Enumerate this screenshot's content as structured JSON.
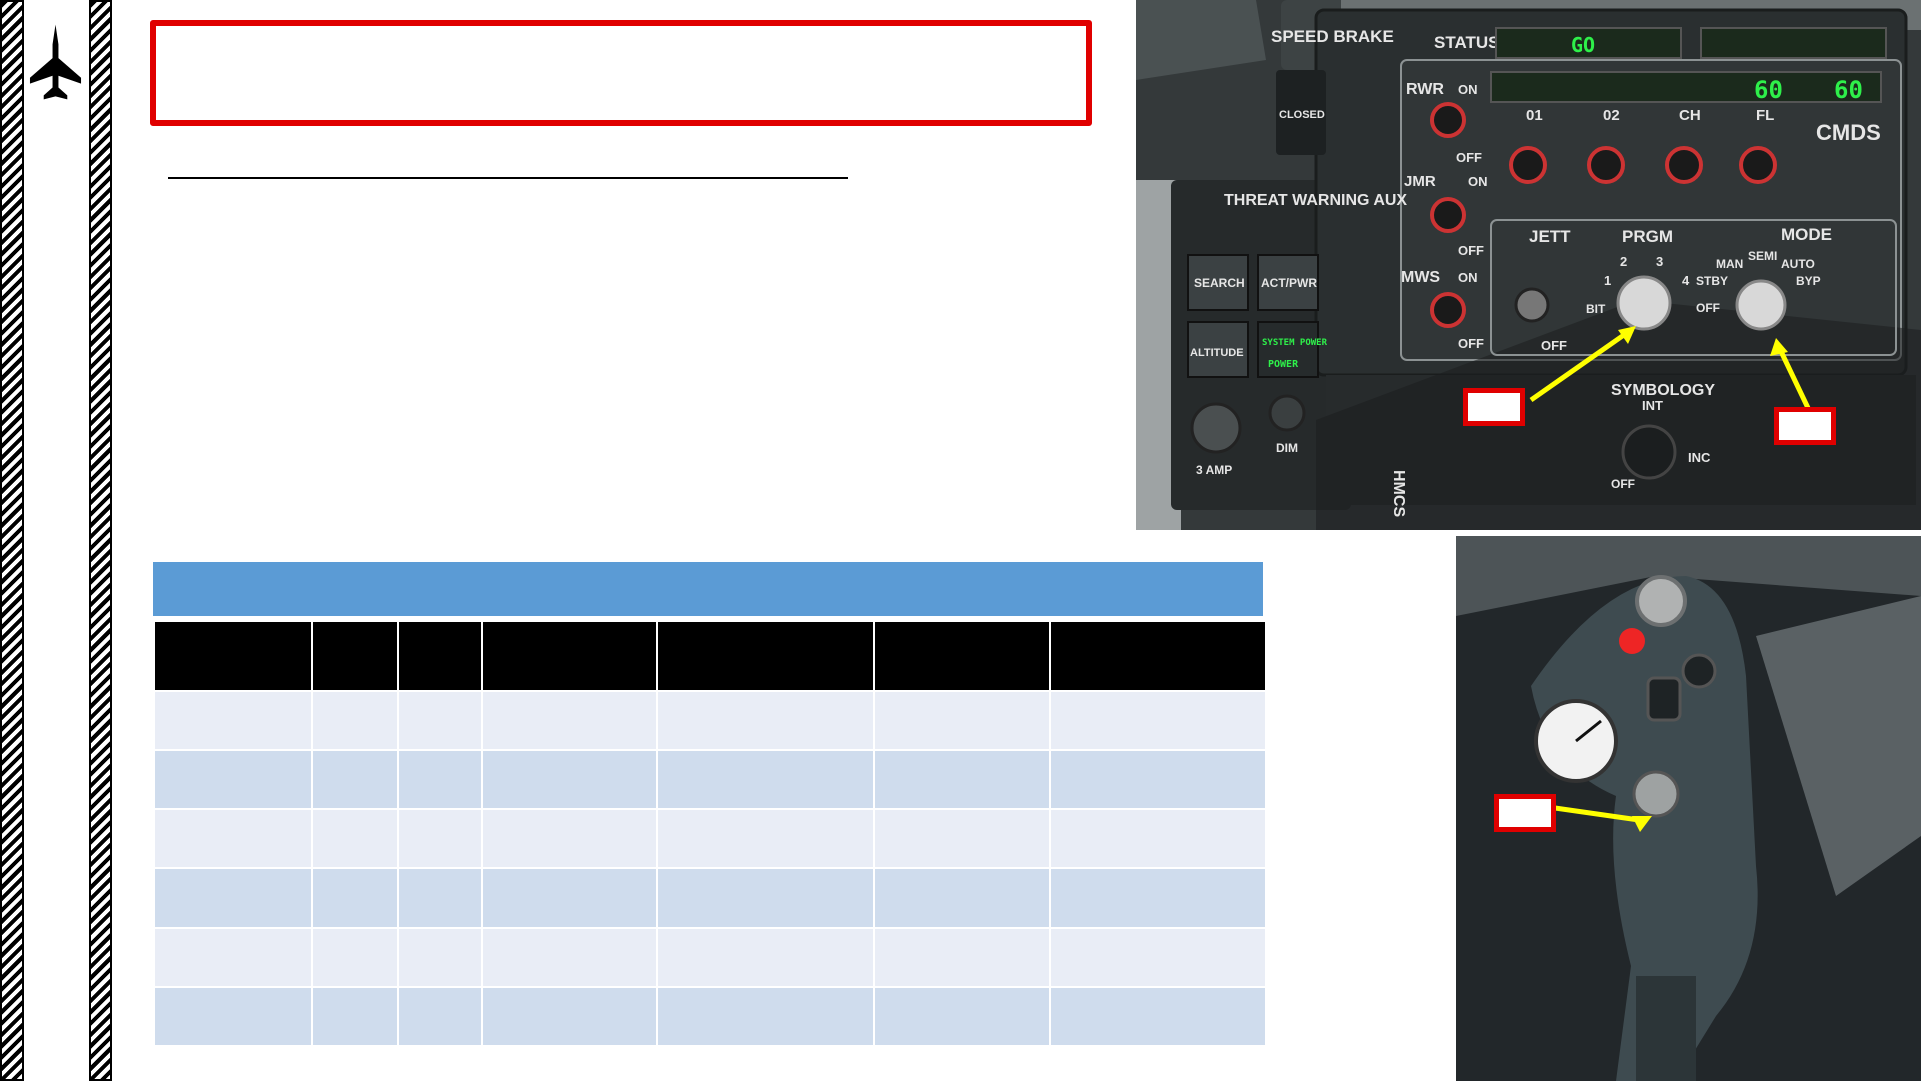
{
  "page": {
    "title": "",
    "subtitle": "",
    "footnote": ""
  },
  "table": {
    "header_title": "",
    "columns": [
      "",
      "",
      "",
      "",
      "",
      "",
      ""
    ],
    "rows": [
      [
        "",
        "",
        "",
        "",
        "",
        "",
        ""
      ],
      [
        "",
        "",
        "",
        "",
        "",
        "",
        ""
      ],
      [
        "",
        "",
        "",
        "",
        "",
        "",
        ""
      ],
      [
        "",
        "",
        "",
        "",
        "",
        "",
        ""
      ],
      [
        "",
        "",
        "",
        "",
        "",
        "",
        ""
      ],
      [
        "",
        "",
        "",
        "",
        "",
        "",
        ""
      ]
    ]
  },
  "cmds_panel": {
    "speed_brake_label": "SPEED BRAKE",
    "closed_label": "CLOSED",
    "status_label": "STATUS",
    "go_display": "GO",
    "chaff_count": "60",
    "flare_count": "60",
    "rwr_label": "RWR",
    "jmr_label": "JMR",
    "mws_label": "MWS",
    "on_label": "ON",
    "off_label": "OFF",
    "switch_01": "01",
    "switch_02": "02",
    "switch_ch": "CH",
    "switch_fl": "FL",
    "cmds_label": "CMDS",
    "jett_label": "JETT",
    "prgm_label": "PRGM",
    "prgm_positions": [
      "BIT",
      "1",
      "2",
      "3",
      "4"
    ],
    "mode_label": "MODE",
    "mode_positions": [
      "OFF",
      "STBY",
      "MAN",
      "SEMI",
      "AUTO",
      "BYP"
    ],
    "threat_warning_aux": "THREAT WARNING AUX",
    "search_label": "SEARCH",
    "act_pwr_label": "ACT/PWR",
    "altitude_label": "ALTITUDE",
    "system_power_label": "SYSTEM POWER",
    "power_label": "POWER",
    "amp_label": "3 AMP",
    "dim_label": "DIM",
    "hmcs_label": "HMCS",
    "symbology_label": "SYMBOLOGY",
    "int_label": "INT",
    "inc_label": "INC",
    "callouts": [
      "",
      ""
    ]
  },
  "stick_photo": {
    "callouts": [
      ""
    ]
  },
  "colors": {
    "accent_red": "#e00000",
    "table_blue": "#5b9bd5",
    "arrow_yellow": "#ffff00",
    "display_green": "#2ef04a"
  }
}
